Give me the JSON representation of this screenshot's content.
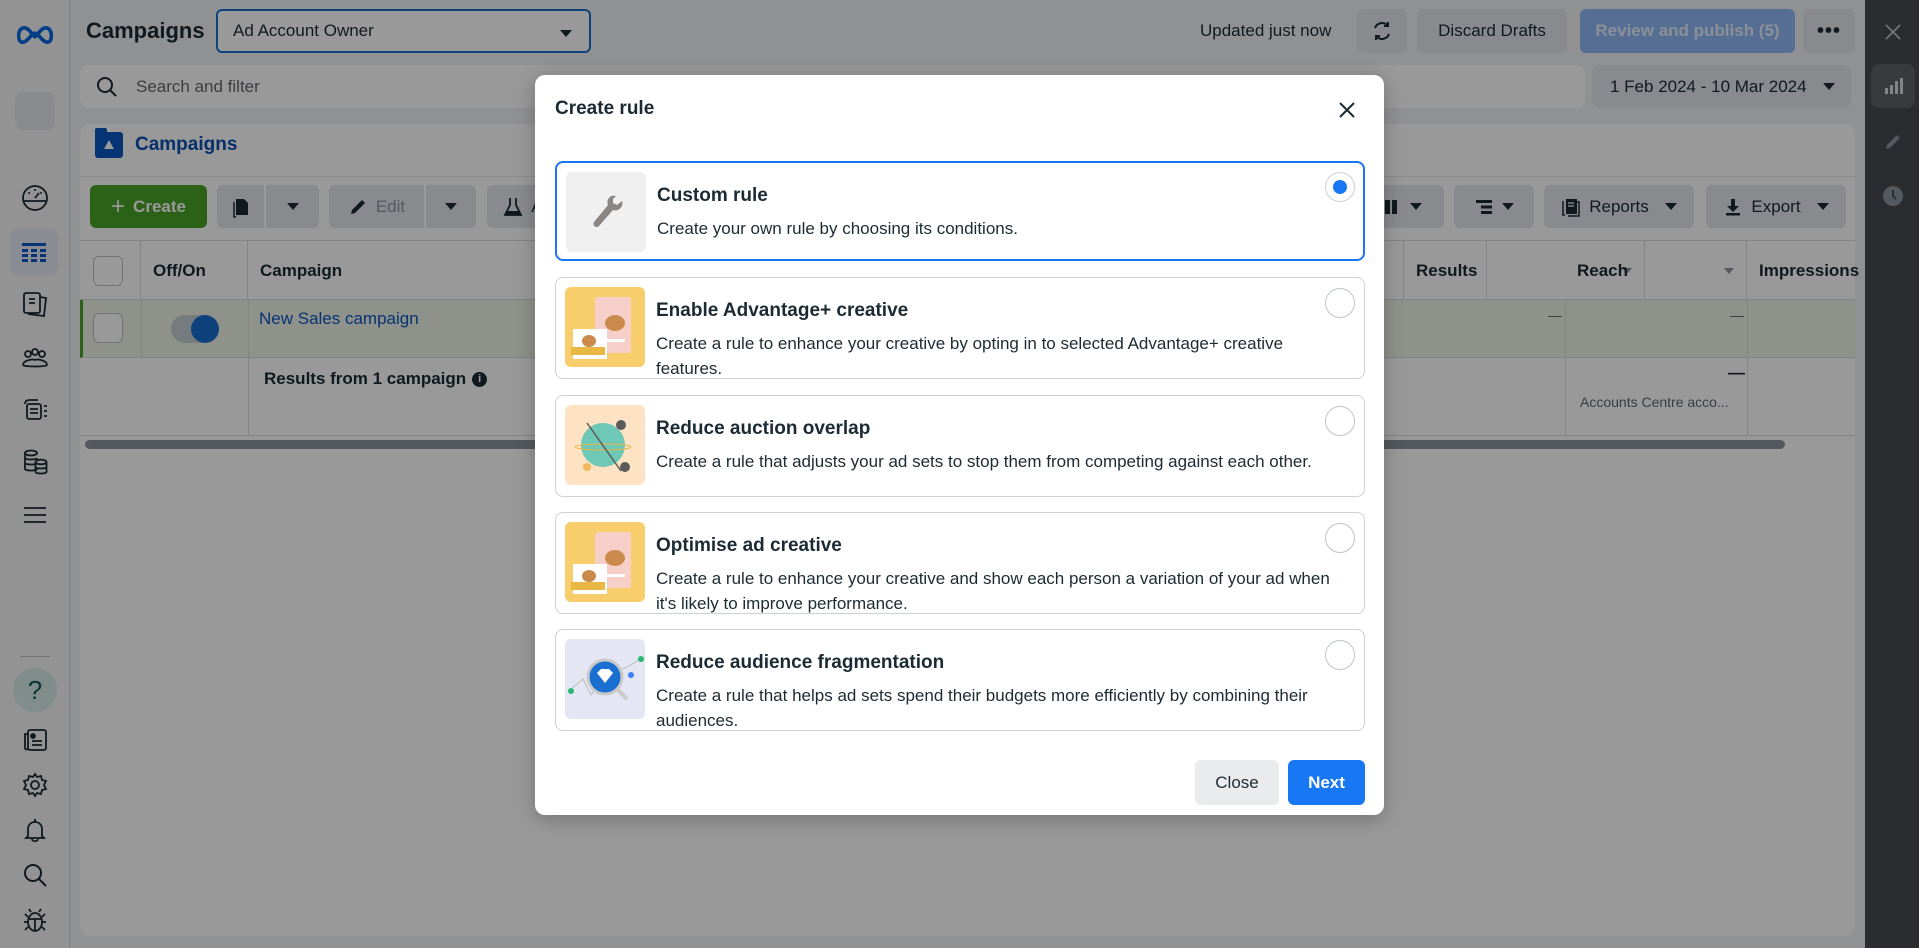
{
  "header": {
    "title": "Campaigns",
    "account_select": "Ad Account Owner",
    "updated_status": "Updated just now",
    "discard_label": "Discard Drafts",
    "publish_label": "Review and publish (5)"
  },
  "search": {
    "placeholder": "Search and filter",
    "value": ""
  },
  "date_range": "1 Feb 2024 - 10 Mar 2024",
  "panel": {
    "tab_label": "Campaigns"
  },
  "toolbar": {
    "create_label": "Create",
    "edit_label": "Edit",
    "ab_test_label": "A/B test",
    "reports_label": "Reports",
    "export_label": "Export"
  },
  "table": {
    "columns": [
      "Off/On",
      "Campaign",
      "Results",
      "Reach",
      "Impressions"
    ],
    "rows": [
      {
        "toggle_on": true,
        "campaign": "New Sales campaign",
        "results": "—",
        "reach": "—",
        "impressions": ""
      }
    ],
    "summary": {
      "label": "Results from 1 campaign",
      "reach": "—",
      "reach_note": "Accounts Centre acco..."
    }
  },
  "modal": {
    "title": "Create rule",
    "options": [
      {
        "title": "Custom rule",
        "description": "Create your own rule by choosing its conditions.",
        "selected": true,
        "icon": "wrench-icon"
      },
      {
        "title": "Enable Advantage+ creative",
        "description": "Create a rule to enhance your creative by opting in to selected Advantage+ creative features.",
        "selected": false,
        "icon": "teapot-creative-illustration"
      },
      {
        "title": "Reduce auction overlap",
        "description": "Create a rule that adjusts your ad sets to stop them from competing against each other.",
        "selected": false,
        "icon": "globe-orbit-illustration"
      },
      {
        "title": "Optimise ad creative",
        "description": "Create a rule to enhance your creative and show each person a variation of your ad when it's likely to improve performance.",
        "selected": false,
        "icon": "teapot-creative-illustration"
      },
      {
        "title": "Reduce audience fragmentation",
        "description": "Create a rule that helps ad sets spend their budgets more efficiently by combining their audiences.",
        "selected": false,
        "icon": "diamond-magnifier-illustration"
      }
    ],
    "close_label": "Close",
    "next_label": "Next"
  },
  "colors": {
    "brand_blue": "#1877f2",
    "create_green": "#4aa229",
    "link_blue": "#0a4fb4"
  }
}
